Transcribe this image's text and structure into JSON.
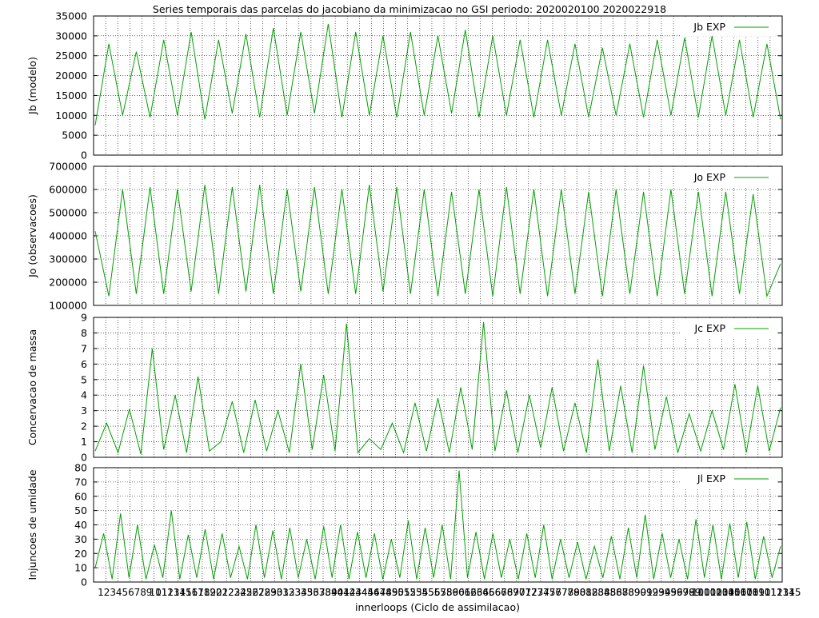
{
  "title": "Series temporais das parcelas do jacobiano da minimizacao no GSI periodo: 2020020100 2020022918",
  "chart_data": [
    {
      "type": "line",
      "ylabel": "Jb (modelo)",
      "ylim": [
        0,
        35000
      ],
      "yticks": [
        "0",
        "5000",
        "10000",
        "15000",
        "20000",
        "25000",
        "30000",
        "35000"
      ],
      "grid": true,
      "legend_position": "top-right",
      "series": [
        {
          "name": "Jb EXP",
          "color": "#00a000",
          "values": [
            7500,
            28000,
            10000,
            26000,
            9500,
            29000,
            10000,
            31000,
            9000,
            29000,
            10500,
            30500,
            9500,
            32000,
            10000,
            31000,
            10500,
            33000,
            9500,
            31000,
            10000,
            30000,
            9500,
            31000,
            10000,
            30000,
            10500,
            31500,
            9500,
            30000,
            10000,
            29000,
            9500,
            29000,
            10000,
            28000,
            9500,
            27000,
            10000,
            28000,
            9500,
            29000,
            10000,
            29500,
            9500,
            30000,
            10000,
            29000,
            9500,
            28000,
            9000
          ]
        }
      ]
    },
    {
      "type": "line",
      "ylabel": "Jo (observacoes)",
      "ylim": [
        100000,
        700000
      ],
      "yticks": [
        "100000",
        "200000",
        "300000",
        "400000",
        "500000",
        "600000",
        "700000"
      ],
      "grid": true,
      "legend_position": "top-right",
      "series": [
        {
          "name": "Jo EXP",
          "color": "#00a000",
          "values": [
            420000,
            140000,
            600000,
            150000,
            610000,
            150000,
            600000,
            160000,
            620000,
            150000,
            610000,
            160000,
            620000,
            150000,
            600000,
            160000,
            610000,
            150000,
            600000,
            150000,
            620000,
            160000,
            610000,
            150000,
            600000,
            140000,
            590000,
            150000,
            600000,
            140000,
            610000,
            150000,
            600000,
            140000,
            600000,
            150000,
            590000,
            140000,
            600000,
            150000,
            590000,
            140000,
            600000,
            150000,
            590000,
            140000,
            590000,
            150000,
            580000,
            140000,
            280000
          ]
        }
      ]
    },
    {
      "type": "line",
      "ylabel": "Concervacao de massa",
      "ylim": [
        0,
        9
      ],
      "yticks": [
        "0",
        "1",
        "2",
        "3",
        "4",
        "5",
        "6",
        "7",
        "8",
        "9"
      ],
      "grid": true,
      "legend_position": "top-right",
      "series": [
        {
          "name": "Jc EXP",
          "color": "#00a000",
          "values": [
            0.4,
            2.2,
            0.3,
            3.1,
            0.2,
            7.0,
            0.5,
            4.0,
            0.3,
            5.2,
            0.4,
            1.0,
            3.6,
            0.3,
            3.7,
            0.4,
            3.0,
            0.3,
            6.0,
            0.5,
            5.3,
            0.4,
            8.6,
            0.3,
            1.2,
            0.5,
            2.2,
            0.3,
            3.5,
            0.4,
            3.8,
            0.3,
            4.5,
            0.5,
            8.7,
            0.4,
            4.3,
            0.3,
            4.0,
            0.6,
            4.5,
            0.4,
            3.5,
            0.3,
            6.3,
            0.4,
            4.6,
            0.3,
            5.9,
            0.5,
            3.9,
            0.3,
            2.8,
            0.4,
            3.0,
            0.5,
            4.7,
            0.3,
            4.6,
            0.4,
            3.2
          ]
        }
      ]
    },
    {
      "type": "line",
      "ylabel": "Injuncoes de umidade",
      "xlabel": "innerloops (Ciclo de assimilacao)",
      "ylim": [
        0,
        80
      ],
      "yticks": [
        "0",
        "10",
        "20",
        "30",
        "40",
        "50",
        "60",
        "70",
        "80"
      ],
      "xtick_labels": [
        "1",
        "2",
        "3",
        "4",
        "5",
        "6",
        "7",
        "8",
        "9",
        "10",
        "11",
        "12",
        "13",
        "14",
        "15",
        "16",
        "17",
        "18",
        "19",
        "20",
        "21",
        "22",
        "23",
        "24",
        "25",
        "26",
        "27",
        "28",
        "29",
        "30",
        "31",
        "32",
        "33",
        "34",
        "35",
        "36",
        "37",
        "38",
        "39",
        "40",
        "41",
        "42",
        "43",
        "44",
        "45",
        "46",
        "47",
        "48",
        "49",
        "50",
        "51",
        "52",
        "53",
        "54",
        "55",
        "56",
        "57",
        "58",
        "59",
        "60",
        "61",
        "62",
        "63",
        "64",
        "65",
        "66",
        "67",
        "68",
        "69",
        "70",
        "71",
        "72",
        "73",
        "74",
        "75",
        "76",
        "77",
        "78",
        "79",
        "80",
        "81",
        "82",
        "83",
        "84",
        "85",
        "86",
        "87",
        "88",
        "89",
        "90",
        "91",
        "92",
        "93",
        "94",
        "95",
        "96",
        "97",
        "98",
        "99",
        "100",
        "101",
        "102",
        "103",
        "104",
        "105",
        "106",
        "107",
        "108",
        "109",
        "110",
        "111",
        "112",
        "113",
        "114",
        "115"
      ],
      "grid": true,
      "legend_position": "top-right",
      "series": [
        {
          "name": "Jl EXP",
          "color": "#00a000",
          "values": [
            10,
            34,
            2,
            48,
            3,
            40,
            2,
            26,
            3,
            50,
            2,
            33,
            3,
            37,
            2,
            34,
            3,
            25,
            2,
            40,
            3,
            36,
            2,
            38,
            3,
            30,
            2,
            39,
            3,
            40,
            2,
            35,
            3,
            34,
            2,
            30,
            3,
            43,
            2,
            38,
            3,
            40,
            2,
            78,
            3,
            35,
            2,
            34,
            3,
            30,
            2,
            34,
            3,
            40,
            2,
            30,
            3,
            28,
            2,
            25,
            3,
            32,
            2,
            38,
            3,
            47,
            2,
            34,
            3,
            30,
            2,
            44,
            3,
            40,
            2,
            41,
            3,
            42,
            2,
            32,
            3,
            25
          ]
        }
      ]
    }
  ]
}
